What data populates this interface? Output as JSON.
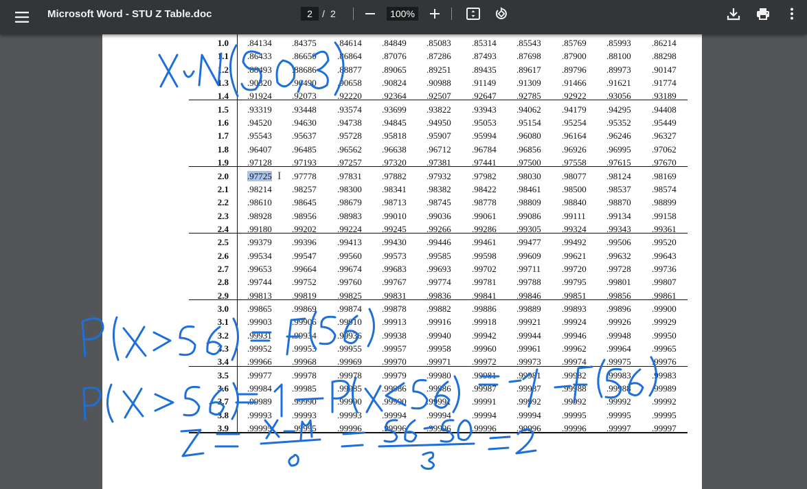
{
  "toolbar": {
    "title": "Microsoft Word - STU Z Table.doc",
    "current_page": "2",
    "page_separator": "/",
    "total_pages": "2",
    "zoom": "100%",
    "icons": [
      "menu-icon",
      "minus-icon",
      "plus-icon",
      "fit-page-icon",
      "rotate-icon",
      "download-icon",
      "print-icon",
      "more-vert-icon"
    ]
  },
  "table": {
    "rows": [
      {
        "z": "1.0",
        "values": [
          ".84134",
          ".84375",
          ".84614",
          ".84849",
          ".85083",
          ".85314",
          ".85543",
          ".85769",
          ".85993",
          ".86214"
        ]
      },
      {
        "z": "1.1",
        "values": [
          ".86433",
          ".86650",
          ".86864",
          ".87076",
          ".87286",
          ".87493",
          ".87698",
          ".87900",
          ".88100",
          ".88298"
        ]
      },
      {
        "z": "1.2",
        "values": [
          ".88493",
          ".88686",
          ".88877",
          ".89065",
          ".89251",
          ".89435",
          ".89617",
          ".89796",
          ".89973",
          ".90147"
        ]
      },
      {
        "z": "1.3",
        "values": [
          ".90320",
          ".90490",
          ".90658",
          ".90824",
          ".90988",
          ".91149",
          ".91309",
          ".91466",
          ".91621",
          ".91774"
        ]
      },
      {
        "z": "1.4",
        "values": [
          ".91924",
          ".92073",
          ".92220",
          ".92364",
          ".92507",
          ".92647",
          ".92785",
          ".92922",
          ".93056",
          ".93189"
        ]
      },
      {
        "z": "1.5",
        "values": [
          ".93319",
          ".93448",
          ".93574",
          ".93699",
          ".93822",
          ".93943",
          ".94062",
          ".94179",
          ".94295",
          ".94408"
        ]
      },
      {
        "z": "1.6",
        "values": [
          ".94520",
          ".94630",
          ".94738",
          ".94845",
          ".94950",
          ".95053",
          ".95154",
          ".95254",
          ".95352",
          ".95449"
        ]
      },
      {
        "z": "1.7",
        "values": [
          ".95543",
          ".95637",
          ".95728",
          ".95818",
          ".95907",
          ".95994",
          ".96080",
          ".96164",
          ".96246",
          ".96327"
        ]
      },
      {
        "z": "1.8",
        "values": [
          ".96407",
          ".96485",
          ".96562",
          ".96638",
          ".96712",
          ".96784",
          ".96856",
          ".96926",
          ".96995",
          ".97062"
        ]
      },
      {
        "z": "1.9",
        "values": [
          ".97128",
          ".97193",
          ".97257",
          ".97320",
          ".97381",
          ".97441",
          ".97500",
          ".97558",
          ".97615",
          ".97670"
        ]
      },
      {
        "z": "2.0",
        "values": [
          ".97725",
          ".97778",
          ".97831",
          ".97882",
          ".97932",
          ".97982",
          ".98030",
          ".98077",
          ".98124",
          ".98169"
        ]
      },
      {
        "z": "2.1",
        "values": [
          ".98214",
          ".98257",
          ".98300",
          ".98341",
          ".98382",
          ".98422",
          ".98461",
          ".98500",
          ".98537",
          ".98574"
        ]
      },
      {
        "z": "2.2",
        "values": [
          ".98610",
          ".98645",
          ".98679",
          ".98713",
          ".98745",
          ".98778",
          ".98809",
          ".98840",
          ".98870",
          ".98899"
        ]
      },
      {
        "z": "2.3",
        "values": [
          ".98928",
          ".98956",
          ".98983",
          ".99010",
          ".99036",
          ".99061",
          ".99086",
          ".99111",
          ".99134",
          ".99158"
        ]
      },
      {
        "z": "2.4",
        "values": [
          ".99180",
          ".99202",
          ".99224",
          ".99245",
          ".99266",
          ".99286",
          ".99305",
          ".99324",
          ".99343",
          ".99361"
        ]
      },
      {
        "z": "2.5",
        "values": [
          ".99379",
          ".99396",
          ".99413",
          ".99430",
          ".99446",
          ".99461",
          ".99477",
          ".99492",
          ".99506",
          ".99520"
        ]
      },
      {
        "z": "2.6",
        "values": [
          ".99534",
          ".99547",
          ".99560",
          ".99573",
          ".99585",
          ".99598",
          ".99609",
          ".99621",
          ".99632",
          ".99643"
        ]
      },
      {
        "z": "2.7",
        "values": [
          ".99653",
          ".99664",
          ".99674",
          ".99683",
          ".99693",
          ".99702",
          ".99711",
          ".99720",
          ".99728",
          ".99736"
        ]
      },
      {
        "z": "2.8",
        "values": [
          ".99744",
          ".99752",
          ".99760",
          ".99767",
          ".99774",
          ".99781",
          ".99788",
          ".99795",
          ".99801",
          ".99807"
        ]
      },
      {
        "z": "2.9",
        "values": [
          ".99813",
          ".99819",
          ".99825",
          ".99831",
          ".99836",
          ".99841",
          ".99846",
          ".99851",
          ".99856",
          ".99861"
        ]
      },
      {
        "z": "3.0",
        "values": [
          ".99865",
          ".99869",
          ".99874",
          ".99878",
          ".99882",
          ".99886",
          ".99889",
          ".99893",
          ".99896",
          ".99900"
        ]
      },
      {
        "z": "3.1",
        "values": [
          ".99903",
          ".99906",
          ".99910",
          ".99913",
          ".99916",
          ".99918",
          ".99921",
          ".99924",
          ".99926",
          ".99929"
        ]
      },
      {
        "z": "3.2",
        "values": [
          ".99931",
          ".99934",
          ".99936",
          ".99938",
          ".99940",
          ".99942",
          ".99944",
          ".99946",
          ".99948",
          ".99950"
        ]
      },
      {
        "z": "3.3",
        "values": [
          ".99952",
          ".99953",
          ".99955",
          ".99957",
          ".99958",
          ".99960",
          ".99961",
          ".99962",
          ".99964",
          ".99965"
        ]
      },
      {
        "z": "3.4",
        "values": [
          ".99966",
          ".99968",
          ".99969",
          ".99970",
          ".99971",
          ".99972",
          ".99973",
          ".99974",
          ".99975",
          ".99976"
        ]
      },
      {
        "z": "3.5",
        "values": [
          ".99977",
          ".99978",
          ".99978",
          ".99979",
          ".99980",
          ".99981",
          ".99981",
          ".99982",
          ".99983",
          ".99983"
        ]
      },
      {
        "z": "3.6",
        "values": [
          ".99984",
          ".99985",
          ".99985",
          ".99986",
          ".99986",
          ".99987",
          ".99987",
          ".99988",
          ".99988",
          ".99989"
        ]
      },
      {
        "z": "3.7",
        "values": [
          ".99989",
          ".99990",
          ".99990",
          ".99990",
          ".99991",
          ".99991",
          ".99992",
          ".99992",
          ".99992",
          ".99992"
        ]
      },
      {
        "z": "3.8",
        "values": [
          ".99993",
          ".99993",
          ".99993",
          ".99994",
          ".99994",
          ".99994",
          ".99994",
          ".99995",
          ".99995",
          ".99995"
        ]
      },
      {
        "z": "3.9",
        "values": [
          ".99995",
          ".99995",
          ".99996",
          ".99996",
          ".99996",
          ".99996",
          ".99996",
          ".99996",
          ".99997",
          ".99997"
        ]
      }
    ],
    "selected_value": ".97725"
  },
  "colors": {
    "ink": "#1e6fd9",
    "selection": "#a9c4ec",
    "toolbar_bg": "#323639",
    "viewer_bg": "#525659"
  }
}
